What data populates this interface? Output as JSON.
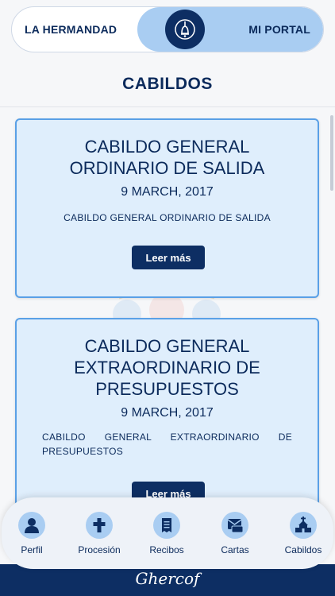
{
  "header": {
    "left_tab": "LA HERMANDAD",
    "right_tab": "MI PORTAL",
    "center_icon": "bell-emblem-icon"
  },
  "page_title": "CABILDOS",
  "cards": [
    {
      "title": "CABILDO GENERAL ORDINARIO DE SALIDA",
      "date": "9 MARCH, 2017",
      "description": "CABILDO GENERAL ORDINARIO DE SALIDA",
      "button": "Leer más"
    },
    {
      "title": "CABILDO GENERAL EXTRAORDINARIO DE PRESUPUESTOS",
      "date": "9 MARCH, 2017",
      "description": "CABILDO GENERAL EXTRAORDINARIO DE PRESUPUESTOS",
      "button": "Leer más"
    }
  ],
  "bottom_nav": [
    {
      "label": "Perfil",
      "icon": "person-icon"
    },
    {
      "label": "Procesión",
      "icon": "cross-icon"
    },
    {
      "label": "Recibos",
      "icon": "receipt-icon"
    },
    {
      "label": "Cartas",
      "icon": "letter-icon"
    },
    {
      "label": "Cabildos",
      "icon": "church-icon"
    }
  ],
  "footer_logo": "Ghercof",
  "colors": {
    "navy": "#0d2e63",
    "light_blue": "#a9cdf2",
    "card_bg": "#dfeefc",
    "card_border": "#5aa0e6"
  }
}
